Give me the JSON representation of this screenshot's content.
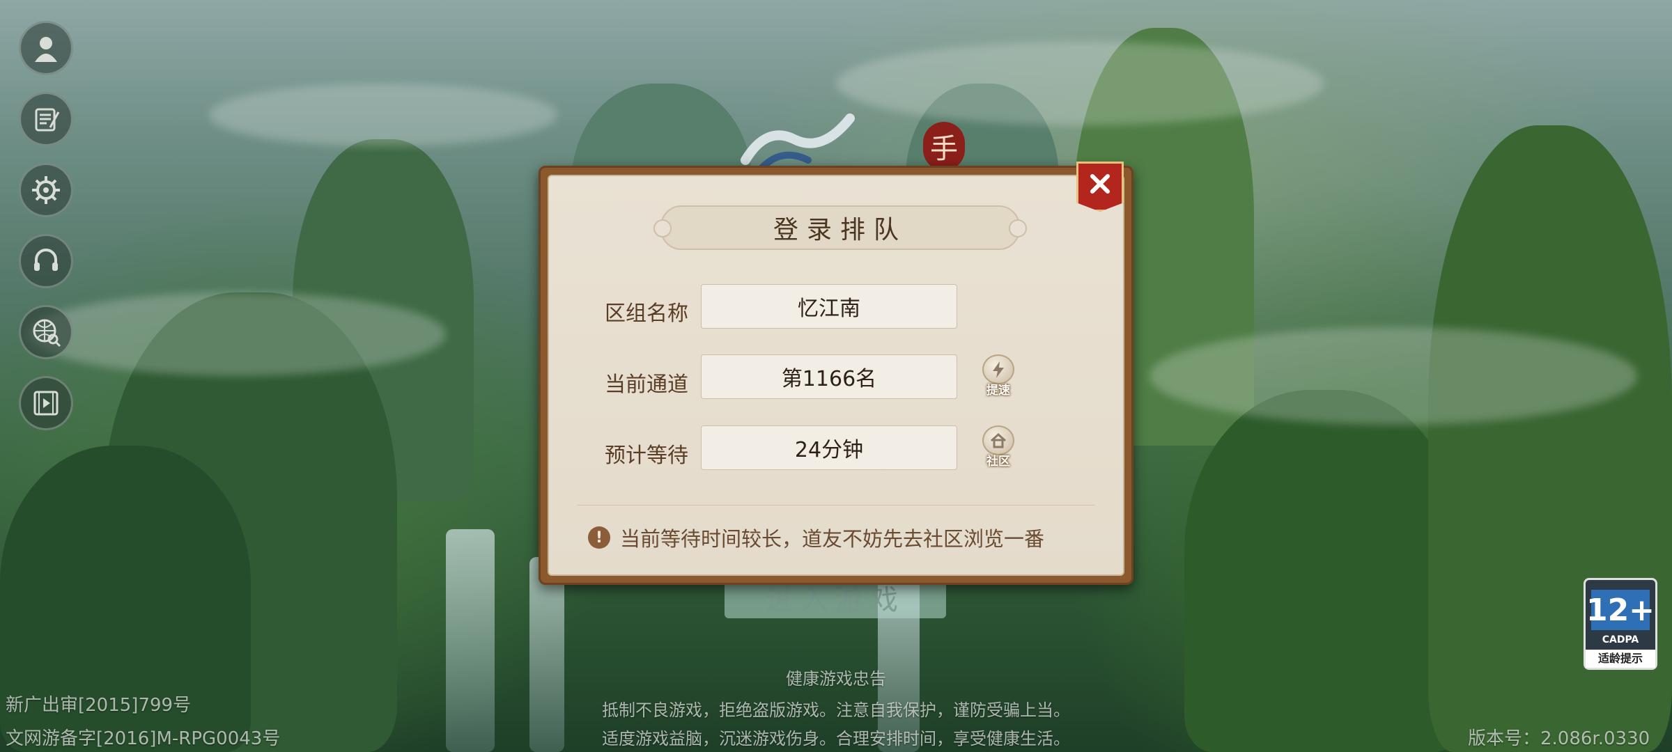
{
  "dialog": {
    "title": "登录排队",
    "rows": [
      {
        "label": "区组名称",
        "value": "忆江南"
      },
      {
        "label": "当前通道",
        "value": "第1166名",
        "button": {
          "icon": "lightning-icon",
          "caption": "提速"
        }
      },
      {
        "label": "预计等待",
        "value": "24分钟",
        "button": {
          "icon": "home-icon",
          "caption": "社区"
        }
      }
    ],
    "notice": "当前等待时间较长，道友不妨先去社区浏览一番",
    "notice_icon": "!"
  },
  "background": {
    "logo_seal": "手",
    "enter_button": "进入游戏"
  },
  "sidebar": [
    "avatar-icon",
    "scroll-icon",
    "settings-icon",
    "headset-icon",
    "globe-search-icon",
    "video-icon"
  ],
  "footer": {
    "license_1": "新广出审[2015]799号",
    "license_2": "文网游备字[2016]M-RPG0043号",
    "health_title": "健康游戏忠告",
    "health_line_1": "抵制不良游戏，拒绝盗版游戏。注意自我保护，谨防受骗上当。",
    "health_line_2": "适度游戏益脑，沉迷游戏伤身。合理安排时间，享受健康生活。",
    "version": "版本号：2.086r.0330"
  },
  "age_rating": {
    "number": "12+",
    "org": "CADPA",
    "tip": "适龄提示",
    "color": "#2e6fb5"
  }
}
